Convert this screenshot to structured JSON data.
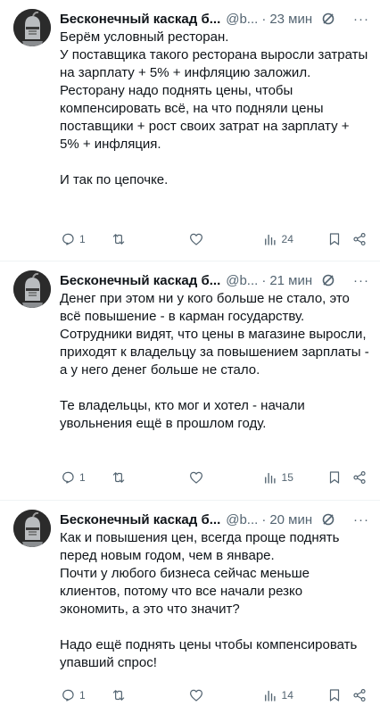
{
  "tweets": [
    {
      "author_name": "Бесконечный каскад б...",
      "handle": "@b...",
      "separator": "·",
      "time": "23 мин",
      "more": "···",
      "text": "Берём условный ресторан.\nУ поставщика такого ресторана выросли затраты на зарплату + 5% + инфляцию заложил.\nРесторану надо поднять цены, чтобы компенсировать всё, на что подняли цены поставщики + рост своих затрат на зарплату + 5% + инфляция.\n\nИ так по цепочке.",
      "replies": "1",
      "views": "24"
    },
    {
      "author_name": "Бесконечный каскад б...",
      "handle": "@b...",
      "separator": "·",
      "time": "21 мин",
      "more": "···",
      "text": "Денег при этом ни у кого больше не стало, это всё повышение - в карман государству.\nСотрудники видят, что цены в магазине выросли, приходят к владельцу за повышением зарплаты - а у него денег больше не стало.\n\nТе владельцы, кто мог и хотел - начали увольнения ещё в прошлом году.",
      "replies": "1",
      "views": "15"
    },
    {
      "author_name": "Бесконечный каскад б...",
      "handle": "@b...",
      "separator": "·",
      "time": "20 мин",
      "more": "···",
      "text": "Как и повышения цен, всегда проще поднять перед новым годом, чем в январе.\nПочти у любого бизнеса сейчас меньше клиентов, потому что все начали резко экономить, а это что значит?\n\nНадо ещё поднять цены чтобы компенсировать упавший спрос!",
      "replies": "1",
      "views": "14"
    }
  ],
  "icons": {
    "reply": "reply-icon",
    "retweet": "retweet-icon",
    "like": "heart-icon",
    "views": "views-chart-icon",
    "bookmark": "bookmark-icon",
    "share": "share-icon",
    "grok": "grok-icon"
  },
  "colors": {
    "text": "#0f1419",
    "muted": "#536471",
    "divider": "#eff3f4"
  }
}
